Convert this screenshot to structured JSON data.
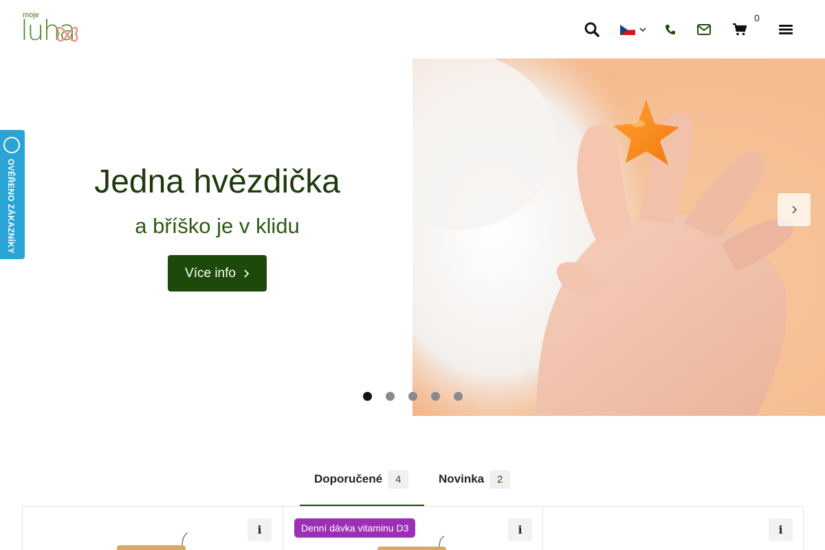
{
  "header": {
    "logo_small": "moje",
    "logo_main": "luha",
    "cart_count": "0",
    "icons": [
      "search-icon",
      "czech-flag-icon",
      "phone-icon",
      "mail-icon",
      "cart-icon",
      "menu-icon"
    ]
  },
  "hero": {
    "title": "Jedna hvězdička",
    "subtitle": "a bříško je v klidu",
    "button_label": "Více info",
    "slides_total": 5,
    "active_slide": 1
  },
  "verified_tab": {
    "label": "OVĚŘENO ZÁKAZNÍKY"
  },
  "tabs": [
    {
      "label": "Doporučené",
      "count": "4",
      "active": true
    },
    {
      "label": "Novinka",
      "count": "2",
      "active": false
    }
  ],
  "products": [
    {
      "badge": ""
    },
    {
      "badge": "Denní dávka vitaminu D3"
    },
    {
      "badge": ""
    }
  ],
  "colors": {
    "brand_green": "#1d4a0a",
    "title_green": "#1d3a0c",
    "subtitle_green": "#2b5a10",
    "badge_purple": "#9b2fb5",
    "verified_blue": "#2aa4d5"
  }
}
